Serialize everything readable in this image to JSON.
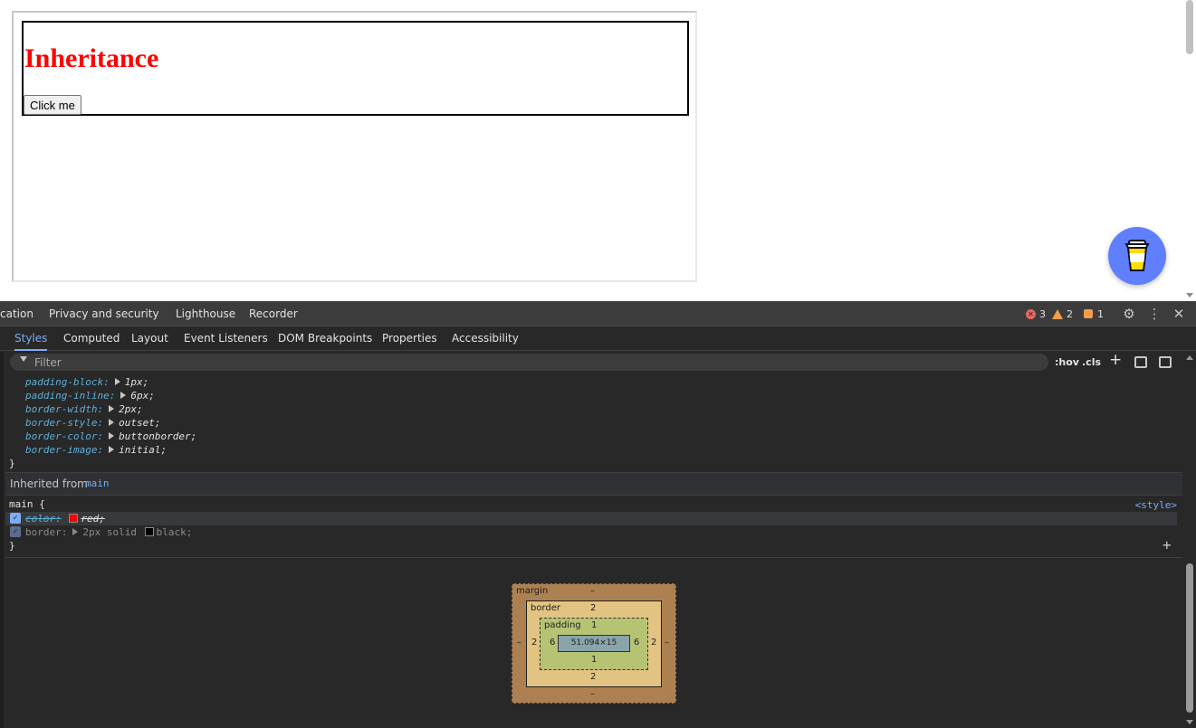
{
  "page": {
    "heading": "Inheritance",
    "button_label": "Click me"
  },
  "devtools": {
    "top_tabs": [
      "cation",
      "Privacy and security",
      "Lighthouse",
      "Recorder"
    ],
    "counters": {
      "errors": "3",
      "warnings": "2",
      "issues": "1"
    },
    "sub_tabs": [
      "Styles",
      "Computed",
      "Layout",
      "Event Listeners",
      "DOM Breakpoints",
      "Properties",
      "Accessibility"
    ],
    "filter_placeholder": "Filter",
    "toolbar": {
      "hov": ":hov",
      "cls": ".cls"
    },
    "declarations": [
      {
        "prop": "padding-block:",
        "val": "1px;"
      },
      {
        "prop": "padding-inline:",
        "val": "6px;"
      },
      {
        "prop": "border-width:",
        "val": "2px;"
      },
      {
        "prop": "border-style:",
        "val": "outset;"
      },
      {
        "prop": "border-color:",
        "val": "buttonborder;"
      },
      {
        "prop": "border-image:",
        "val": "initial;"
      }
    ],
    "close_brace": "}",
    "inherited_label": "Inherited from",
    "inherited_link": "main",
    "rule": {
      "selector": "main {",
      "source": "<style>",
      "color_prop": "color:",
      "color_val": "red;",
      "border_prop": "border:",
      "border_val_a": "2px solid",
      "border_val_b": "black;",
      "close": "}"
    },
    "box_model": {
      "margin_label": "margin",
      "border_label": "border",
      "padding_label": "padding",
      "margin_top": "–",
      "margin_bottom": "–",
      "margin_left": "–",
      "margin_right": "–",
      "border_top": "2",
      "border_bottom": "2",
      "border_left": "2",
      "border_right": "2",
      "padding_top": "1",
      "padding_bottom": "1",
      "padding_left": "6",
      "padding_right": "6",
      "content": "51.094×15"
    }
  },
  "colors": {
    "heading": "#ff0000",
    "accent": "#7cacf8",
    "fab": "#5f7fff",
    "swatch_red": "#ff0000",
    "swatch_black": "#000000"
  }
}
